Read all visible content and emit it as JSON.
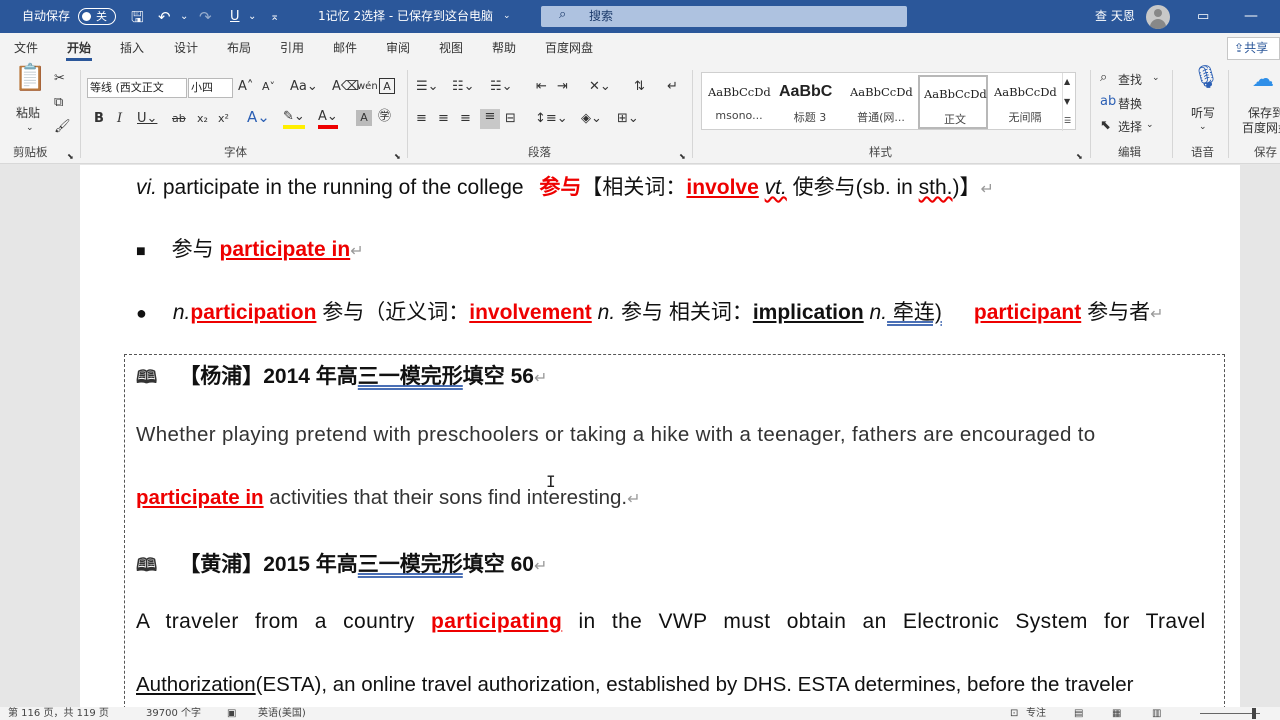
{
  "titlebar": {
    "autosave_label": "自动保存",
    "autosave_state": "关",
    "doc_title": "1记忆 2选择 - 已保存到这台电脑",
    "search_placeholder": "搜索",
    "user_name": "查 天恩"
  },
  "tabs": [
    {
      "label": "文件"
    },
    {
      "label": "开始",
      "active": true
    },
    {
      "label": "插入"
    },
    {
      "label": "设计"
    },
    {
      "label": "布局"
    },
    {
      "label": "引用"
    },
    {
      "label": "邮件"
    },
    {
      "label": "审阅"
    },
    {
      "label": "视图"
    },
    {
      "label": "帮助"
    },
    {
      "label": "百度网盘"
    }
  ],
  "share_label": "共享",
  "ribbon": {
    "clipboard": {
      "paste": "粘贴",
      "group": "剪贴板"
    },
    "font": {
      "name": "等线 (西文正文",
      "size": "小四",
      "group": "字体"
    },
    "paragraph": {
      "group": "段落"
    },
    "styles": {
      "group": "样式",
      "items": [
        {
          "preview": "AaBbCcDd",
          "name": "msono..."
        },
        {
          "preview": "AaBbC",
          "name": "标题 3"
        },
        {
          "preview": "AaBbCcDd",
          "name": "普通(网..."
        },
        {
          "preview": "AaBbCcDd",
          "name": "正文"
        },
        {
          "preview": "AaBbCcDd",
          "name": "无间隔"
        }
      ]
    },
    "editing": {
      "find": "查找",
      "replace": "替换",
      "select": "选择",
      "group": "编辑"
    },
    "voice": {
      "dictate": "听写",
      "group": "语音"
    },
    "save": {
      "label1": "保存到",
      "label2": "百度网盘",
      "group": "保存"
    }
  },
  "doc": {
    "l1": {
      "a": "vi.",
      "b": " participate in the running of the college ",
      "c": "参与",
      "d": "【相关词：",
      "e": "involve",
      "f": "vt.",
      "g": " 使参与(sb. in ",
      "h": "sth.",
      "i": ")】"
    },
    "l2": {
      "bullet": "■",
      "a": "参与 ",
      "b": "participate in"
    },
    "l3": {
      "bullet": "●",
      "a": "n.",
      "b": "participation",
      "c": " 参与（近义词：",
      "d": "involvement",
      "e": "n.",
      "f": " 参与 相关词：",
      "g": "implication",
      "h": "n.",
      "i": " 牵连)",
      "j": "participant",
      "k": " 参与者"
    },
    "ex1": {
      "a": "【杨浦】2014 年高",
      "b": "三一模完形",
      "c": "填空 56"
    },
    "p1": "Whether playing pretend with preschoolers or taking a hike with a teenager, fathers are encouraged to",
    "p2": {
      "a": "participate in",
      "b": " activities that their sons find interesting."
    },
    "ex2": {
      "a": "【黄浦】2015 年高",
      "b": "三一模完形",
      "c": "填空 60"
    },
    "p3": {
      "a": "A traveler from a country ",
      "b": "participating",
      "c": " in the VWP must obtain an Electronic System for Travel"
    },
    "p4": {
      "a": "Authorization",
      "b": "(ESTA), an online travel authorization, established by DHS. ESTA determines, before the traveler"
    },
    "para_mark": "↵"
  },
  "status": {
    "page": "第 116 页，共 119 页",
    "words": "39700 个字",
    "lang": "英语(美国)",
    "focus": "专注"
  }
}
